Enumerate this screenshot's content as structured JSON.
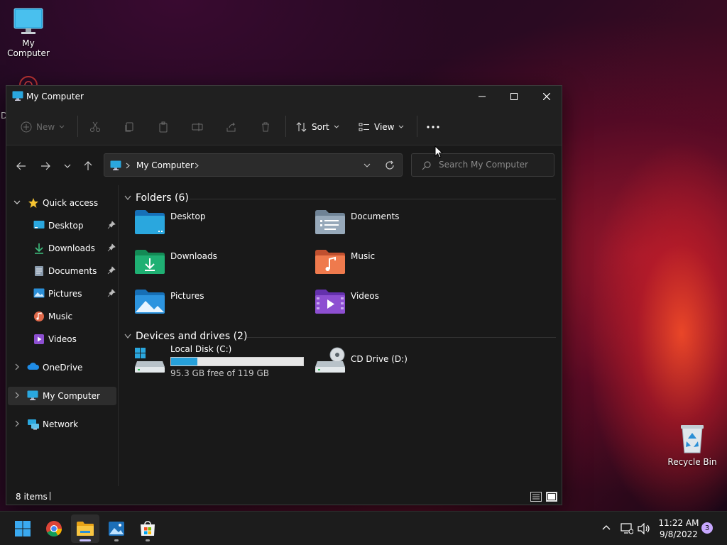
{
  "desktop": {
    "icons": [
      {
        "label": "My Computer"
      },
      {
        "label": "Recycle Bin"
      }
    ],
    "partial_letter": "D"
  },
  "window": {
    "title": "My Computer",
    "toolbar": {
      "new_label": "New",
      "sort_label": "Sort",
      "view_label": "View"
    },
    "address": {
      "crumb": "My Computer",
      "search_placeholder": "Search My Computer"
    },
    "nav": {
      "quick_access": "Quick access",
      "pinned": [
        {
          "label": "Desktop"
        },
        {
          "label": "Downloads"
        },
        {
          "label": "Documents"
        },
        {
          "label": "Pictures"
        },
        {
          "label": "Music"
        },
        {
          "label": "Videos"
        }
      ],
      "onedrive": "OneDrive",
      "my_computer": "My Computer",
      "network": "Network"
    },
    "folders_header": "Folders (6)",
    "folders": [
      {
        "label": "Desktop"
      },
      {
        "label": "Documents"
      },
      {
        "label": "Downloads"
      },
      {
        "label": "Music"
      },
      {
        "label": "Pictures"
      },
      {
        "label": "Videos"
      }
    ],
    "drives_header": "Devices and drives (2)",
    "drives": [
      {
        "label": "Local Disk (C:)",
        "free_text": "95.3 GB free of 119 GB",
        "used_fraction": 0.199
      },
      {
        "label": "CD Drive (D:)"
      }
    ],
    "status": {
      "item_count": "8 items"
    }
  },
  "taskbar": {
    "time": "11:22 AM",
    "date": "9/8/2022",
    "notification_count": "3"
  },
  "colors": {
    "accent": "#26a0da",
    "window_bg": "#191919",
    "toolbar_bg": "#202020"
  }
}
